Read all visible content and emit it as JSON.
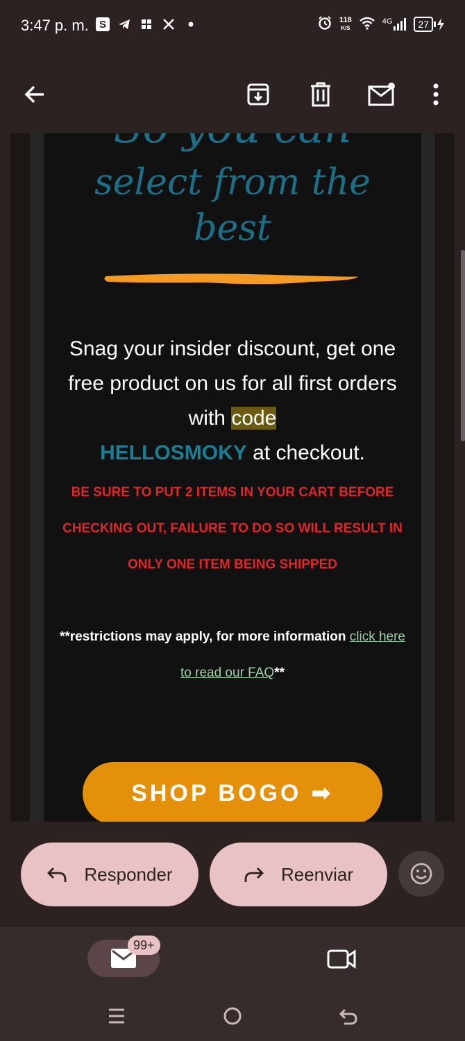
{
  "status_bar": {
    "time": "3:47 p. m.",
    "icons": [
      "s-app-icon",
      "telegram-icon",
      "photos-icon",
      "x-icon",
      "dot-icon"
    ],
    "net_speed_value": "118",
    "net_speed_unit": "K/S",
    "network": "4G",
    "battery": "27"
  },
  "app_bar": {
    "icons": [
      "back-arrow-icon",
      "archive-icon",
      "delete-icon",
      "mark-unread-icon",
      "more-vert-icon"
    ]
  },
  "email": {
    "headline_partial": "So you can",
    "headline_line1": "select from the",
    "headline_line2": "best",
    "promo_part1": "Snag your insider discount, get one free product on us for all first orders with ",
    "promo_code_word": "code",
    "promo_code": "HELLOSMOKY",
    "promo_part2": " at checkout.",
    "warning": "BE SURE TO PUT 2 ITEMS IN YOUR CART BEFORE CHECKING OUT, FAILURE TO DO SO WILL RESULT IN ONLY ONE ITEM BEING SHIPPED",
    "restrictions_prefix": "**restrictions may apply, for more information ",
    "faq_link": "click here to read our FAQ",
    "restrictions_suffix": "**",
    "shop_button": "SHOP BOGO",
    "shop_arrow": "➡",
    "colors": {
      "accent_orange": "#e4900a",
      "teal": "#1c6f86",
      "warning_red": "#e0262a"
    }
  },
  "reply_bar": {
    "reply_label": "Responder",
    "forward_label": "Reenviar"
  },
  "bottom_nav": {
    "mail_badge": "99+"
  }
}
